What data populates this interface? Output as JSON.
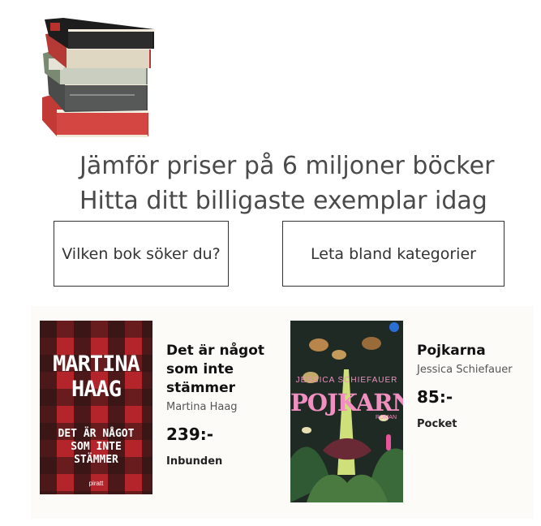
{
  "hero": {
    "headline_line1": "Jämför priser på 6 miljoner böcker",
    "headline_line2": "Hitta ditt billigaste exemplar idag"
  },
  "actions": {
    "search_label": "Vilken bok söker du?",
    "categories_label": "Leta bland kategorier"
  },
  "books": [
    {
      "title": "Det är något som inte stämmer",
      "author": "Martina Haag",
      "price": "239:-",
      "format": "Inbunden",
      "cover_author": "MARTINA HAAG",
      "cover_title": "DET ÄR NÅGOT SOM INTE STÄMMER",
      "cover_publisher": "piratt",
      "cover_colors": {
        "red": "#b4252b",
        "dark": "#2a1414"
      }
    },
    {
      "title": "Pojkarna",
      "author": "Jessica Schiefauer",
      "price": "85:-",
      "format": "Pocket",
      "cover_author": "JESSICA SCHIEFAUER",
      "cover_title": "POJKARNA",
      "cover_genre": "ROMAN",
      "cover_colors": {
        "bg": "#1f2a24",
        "accent": "#e8549a",
        "title": "#f08fc0"
      }
    }
  ]
}
